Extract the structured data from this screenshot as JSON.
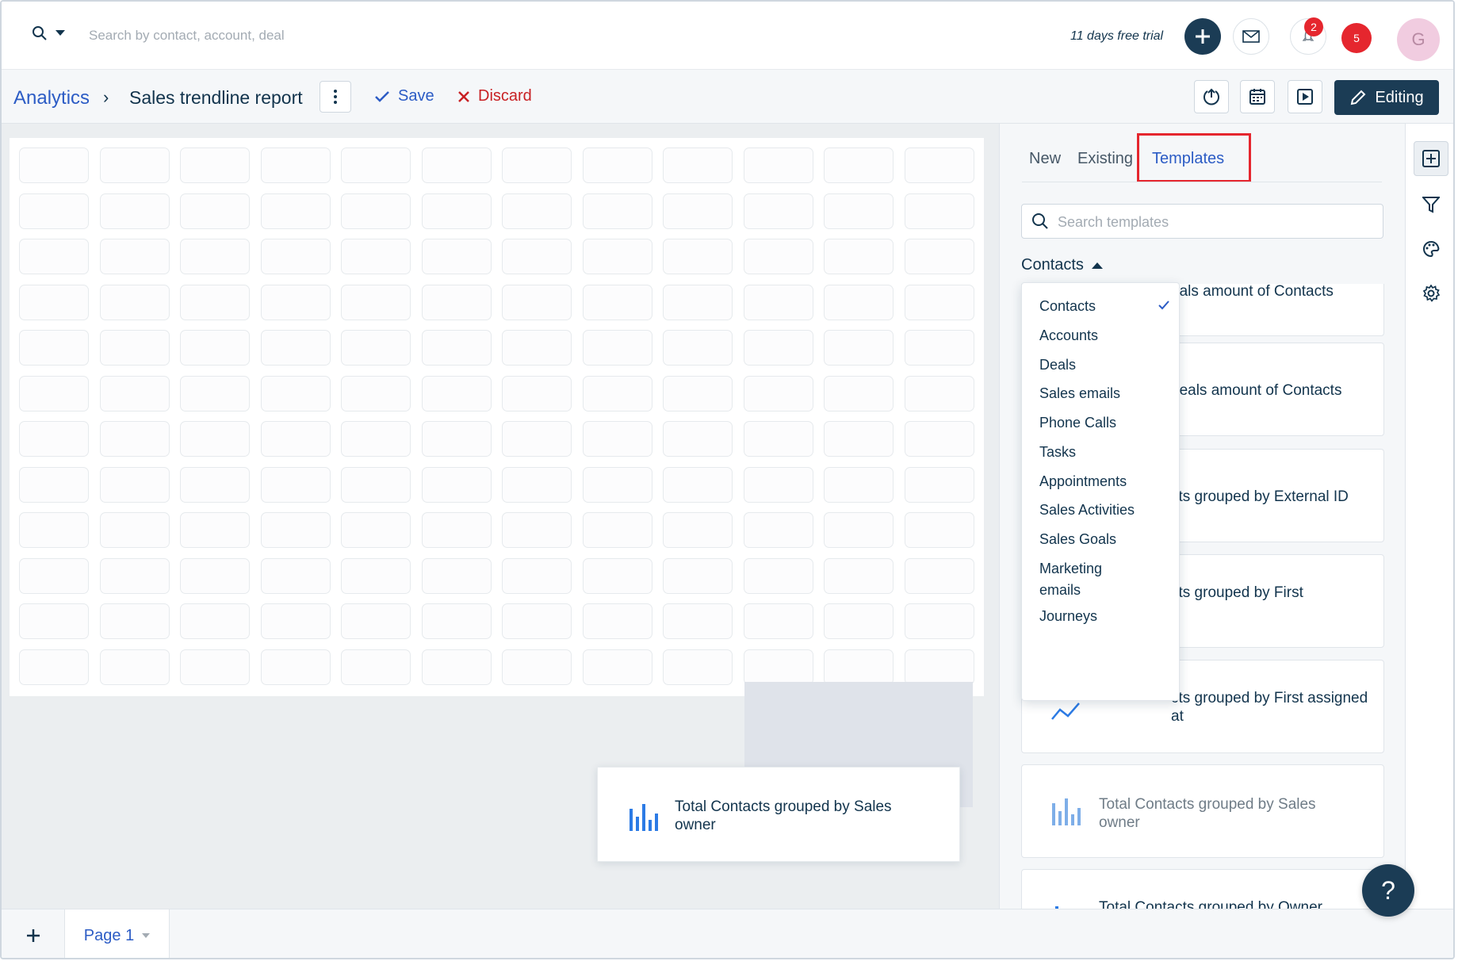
{
  "topbar": {
    "search_placeholder": "Search by contact, account, deal",
    "trial_text": "11 days free trial",
    "notification_count": "2",
    "alert_count": "5",
    "avatar_initial": "G"
  },
  "subbar": {
    "breadcrumb": "Analytics",
    "report_title": "Sales trendline report",
    "save_label": "Save",
    "discard_label": "Discard",
    "editing_label": "Editing"
  },
  "canvas": {
    "dragging_card_label": "Total Contacts grouped by Sales owner"
  },
  "panel": {
    "tabs": [
      {
        "label": "New"
      },
      {
        "label": "Existing"
      },
      {
        "label": "Templates"
      }
    ],
    "active_tab": "Templates",
    "search_placeholder": "Search templates",
    "category_label": "Contacts",
    "dropdown": {
      "selected": "Contacts",
      "options": [
        "Contacts",
        "Accounts",
        "Deals",
        "Sales emails",
        "Phone Calls",
        "Tasks",
        "Appointments",
        "Sales Activities",
        "Sales Goals",
        "Marketing emails",
        "Journeys"
      ]
    },
    "templates": [
      {
        "label": "...eals amount of Contacts"
      },
      {
        "label": "...deals amount of Contacts"
      },
      {
        "label": "...cts grouped by External ID"
      },
      {
        "label": "...cts grouped by First"
      },
      {
        "label": "...cts grouped by First assigned at"
      },
      {
        "label": "Total Contacts grouped by Sales owner"
      },
      {
        "label": "Total Contacts grouped by Owner"
      }
    ],
    "templates_visible": {
      "t1": "eals amount of Contacts",
      "t2": "deals amount of Contacts",
      "t3": "cts grouped by External ID",
      "t4": "cts grouped by First",
      "t5": "cts grouped by First assigned at",
      "t6": "Total Contacts grouped by Sales owner",
      "t7": "Total Contacts grouped by Owner"
    }
  },
  "pagebar": {
    "page_label": "Page 1"
  },
  "colors": {
    "primary_dark": "#1b3c55",
    "link_blue": "#2c5cc5",
    "danger_red": "#c82124",
    "highlight_red": "#e5262e"
  }
}
